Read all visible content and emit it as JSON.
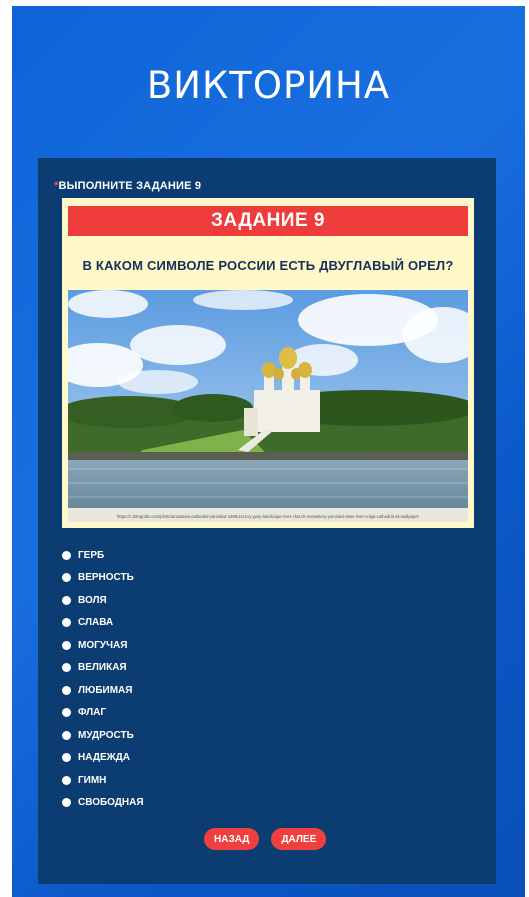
{
  "page": {
    "title": "ВИКТОРИНА"
  },
  "question": {
    "required_mark": "*",
    "prompt": "ВЫПОЛНИТЕ ЗАДАНИЕ 9",
    "task_header": "ЗАДАНИЕ 9",
    "task_text": "В КАКОМ СИМВОЛЕ РОССИИ ЕСТЬ ДВУГЛАВЫЙ ОРЕЛ?",
    "image_caption": "https://c.fotografiz.com/photo/anastasia-cathedral-yaroslavl-1696/1s1m/y-grey-landscape-river-church-monastery-yaroslavl-town-river-volga-cathedral-4k-wallpaper"
  },
  "options": [
    "ГЕРБ",
    "ВЕРНОСТЬ",
    "ВОЛЯ",
    "СЛАВА",
    "МОГУЧАЯ",
    "ВЕЛИКАЯ",
    "ЛЮБИМАЯ",
    "ФЛАГ",
    "МУДРОСТЬ",
    "НАДЕЖДА",
    "ГИМН",
    "СВОБОДНАЯ"
  ],
  "buttons": {
    "back": "НАЗАД",
    "next": "ДАЛЕЕ"
  },
  "colors": {
    "background": "#0e63d6",
    "card": "#0b3d72",
    "accent": "#ee3b3b",
    "task_bg": "#fff8c8"
  }
}
